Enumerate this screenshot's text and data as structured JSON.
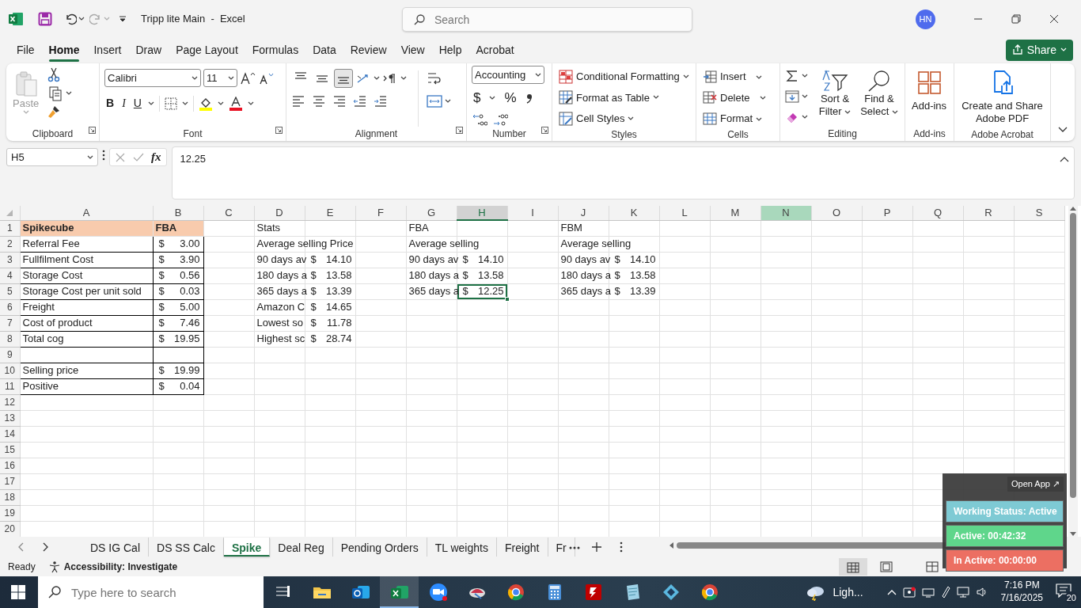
{
  "title_bar": {
    "title": "Tripp lite Main  -  Excel",
    "search_placeholder": "Search",
    "avatar": "HN"
  },
  "menu_tabs": [
    {
      "label": "File",
      "selected": false
    },
    {
      "label": "Home",
      "selected": true
    },
    {
      "label": "Insert",
      "selected": false
    },
    {
      "label": "Draw",
      "selected": false
    },
    {
      "label": "Page Layout",
      "selected": false
    },
    {
      "label": "Formulas",
      "selected": false
    },
    {
      "label": "Data",
      "selected": false
    },
    {
      "label": "Review",
      "selected": false
    },
    {
      "label": "View",
      "selected": false
    },
    {
      "label": "Help",
      "selected": false
    },
    {
      "label": "Acrobat",
      "selected": false
    }
  ],
  "share_button": {
    "label": "Share"
  },
  "ribbon": [
    {
      "kind": "clipboard",
      "label": "Clipboard",
      "paste": "Paste"
    },
    {
      "kind": "font",
      "label": "Font",
      "font_name": "Calibri",
      "font_size": "11",
      "bold": "B",
      "italic": "I",
      "underline": "U"
    },
    {
      "kind": "alignment",
      "label": "Alignment",
      "vertical_align": [
        {
          "selected": false
        },
        {
          "selected": false
        },
        {
          "selected": true
        }
      ]
    },
    {
      "kind": "number",
      "label": "Number",
      "format": "Accounting",
      "currency": "$",
      "percent": "%"
    },
    {
      "kind": "styles",
      "label": "Styles",
      "items": [
        "Conditional Formatting",
        "Format as Table",
        "Cell Styles"
      ]
    },
    {
      "kind": "cells",
      "label": "Cells",
      "items": [
        "Insert",
        "Delete",
        "Format"
      ]
    },
    {
      "kind": "editing",
      "label": "Editing",
      "items": [
        "Sort & Filter",
        "Find & Select"
      ]
    },
    {
      "kind": "addins",
      "label": "Add-ins",
      "items": [
        "Add-ins"
      ]
    },
    {
      "kind": "acrobat",
      "label": "Adobe Acrobat",
      "items": [
        "Create and Share Adobe PDF"
      ]
    }
  ],
  "formula_bar": {
    "name_box": "H5",
    "fx": "fx",
    "formula": "12.25"
  },
  "sheet": {
    "columns": [
      {
        "label": "A",
        "selected": false,
        "highlighted": false
      },
      {
        "label": "B",
        "selected": false,
        "highlighted": false
      },
      {
        "label": "C",
        "selected": false,
        "highlighted": false
      },
      {
        "label": "D",
        "selected": false,
        "highlighted": false
      },
      {
        "label": "E",
        "selected": false,
        "highlighted": false
      },
      {
        "label": "F",
        "selected": false,
        "highlighted": false
      },
      {
        "label": "G",
        "selected": false,
        "highlighted": false
      },
      {
        "label": "H",
        "selected": true,
        "highlighted": false
      },
      {
        "label": "I",
        "selected": false,
        "highlighted": false
      },
      {
        "label": "J",
        "selected": false,
        "highlighted": false
      },
      {
        "label": "K",
        "selected": false,
        "highlighted": false
      },
      {
        "label": "L",
        "selected": false,
        "highlighted": false
      },
      {
        "label": "M",
        "selected": false,
        "highlighted": false
      },
      {
        "label": "N",
        "selected": false,
        "highlighted": true
      },
      {
        "label": "O",
        "selected": false,
        "highlighted": false
      },
      {
        "label": "P",
        "selected": false,
        "highlighted": false
      },
      {
        "label": "Q",
        "selected": false,
        "highlighted": false
      },
      {
        "label": "R",
        "selected": false,
        "highlighted": false
      },
      {
        "label": "S",
        "selected": false,
        "highlighted": false
      }
    ],
    "rows": [
      {
        "label": "1",
        "cells": [
          {
            "kind": "header",
            "text": "Spikecube"
          },
          {
            "kind": "header",
            "text": "FBA"
          },
          null,
          {
            "kind": "plain",
            "text": "Stats"
          },
          null,
          null,
          {
            "kind": "plain",
            "text": "FBA"
          },
          null,
          null,
          {
            "kind": "plain",
            "text": "FBM"
          }
        ]
      },
      {
        "label": "2",
        "cells": [
          {
            "kind": "table",
            "text": "Referral Fee"
          },
          {
            "kind": "table",
            "symbol": "$",
            "amount": "3.00"
          },
          null,
          {
            "kind": "plain",
            "text": "Average selling Price"
          },
          null,
          null,
          {
            "kind": "plain",
            "text": "Average selling"
          },
          null,
          null,
          {
            "kind": "plain",
            "text": "Average selling"
          }
        ]
      },
      {
        "label": "3",
        "cells": [
          {
            "kind": "table",
            "text": "Fullfilment Cost"
          },
          {
            "kind": "table",
            "symbol": "$",
            "amount": "3.90"
          },
          null,
          {
            "kind": "plain",
            "text": "90 days av"
          },
          {
            "kind": "plain",
            "symbol": "$",
            "amount": "14.10"
          },
          null,
          {
            "kind": "plain",
            "text": "90 days av"
          },
          {
            "kind": "plain",
            "symbol": "$",
            "amount": "14.10"
          },
          null,
          {
            "kind": "plain",
            "text": "90 days av"
          },
          {
            "kind": "plain",
            "symbol": "$",
            "amount": "14.10"
          }
        ]
      },
      {
        "label": "4",
        "cells": [
          {
            "kind": "table",
            "text": "Storage Cost"
          },
          {
            "kind": "table",
            "symbol": "$",
            "amount": "0.56"
          },
          null,
          {
            "kind": "plain",
            "text": "180 days a"
          },
          {
            "kind": "plain",
            "symbol": "$",
            "amount": "13.58"
          },
          null,
          {
            "kind": "plain",
            "text": "180 days a"
          },
          {
            "kind": "plain",
            "symbol": "$",
            "amount": "13.58"
          },
          null,
          {
            "kind": "plain",
            "text": "180 days a"
          },
          {
            "kind": "plain",
            "symbol": "$",
            "amount": "13.58"
          }
        ]
      },
      {
        "label": "5",
        "cells": [
          {
            "kind": "table",
            "text": "Storage Cost per unit sold"
          },
          {
            "kind": "table",
            "symbol": "$",
            "amount": "0.03"
          },
          null,
          {
            "kind": "plain",
            "text": "365 days a"
          },
          {
            "kind": "plain",
            "symbol": "$",
            "amount": "13.39"
          },
          null,
          {
            "kind": "plain",
            "text": "365 days a"
          },
          {
            "kind": "plain",
            "symbol": "$",
            "amount": "12.25",
            "selected": true
          },
          null,
          {
            "kind": "plain",
            "text": "365 days a"
          },
          {
            "kind": "plain",
            "symbol": "$",
            "amount": "13.39"
          }
        ]
      },
      {
        "label": "6",
        "cells": [
          {
            "kind": "table",
            "text": "Freight"
          },
          {
            "kind": "table",
            "symbol": "$",
            "amount": "5.00"
          },
          null,
          {
            "kind": "plain",
            "text": "Amazon C"
          },
          {
            "kind": "plain",
            "symbol": "$",
            "amount": "14.65"
          }
        ]
      },
      {
        "label": "7",
        "cells": [
          {
            "kind": "table",
            "text": "Cost of product"
          },
          {
            "kind": "table",
            "symbol": "$",
            "amount": "7.46"
          },
          null,
          {
            "kind": "plain",
            "text": "Lowest so"
          },
          {
            "kind": "plain",
            "symbol": "$",
            "amount": "11.78"
          }
        ]
      },
      {
        "label": "8",
        "cells": [
          {
            "kind": "table",
            "text": "Total cog"
          },
          {
            "kind": "table",
            "symbol": "$",
            "amount": "19.95"
          },
          null,
          {
            "kind": "plain",
            "text": "Highest sc"
          },
          {
            "kind": "plain",
            "symbol": "$",
            "amount": "28.74"
          }
        ]
      },
      {
        "label": "9",
        "cells": [
          {
            "kind": "table"
          },
          {
            "kind": "table"
          }
        ]
      },
      {
        "label": "10",
        "cells": [
          {
            "kind": "table",
            "text": "Selling price"
          },
          {
            "kind": "table",
            "symbol": "$",
            "amount": "19.99"
          }
        ]
      },
      {
        "label": "11",
        "cells": [
          {
            "kind": "table",
            "text": "Positive"
          },
          {
            "kind": "table",
            "symbol": "$",
            "amount": "0.04"
          }
        ]
      },
      {
        "label": "12"
      },
      {
        "label": "13"
      },
      {
        "label": "14"
      },
      {
        "label": "15"
      },
      {
        "label": "16"
      },
      {
        "label": "17"
      },
      {
        "label": "18"
      },
      {
        "label": "19"
      },
      {
        "label": "20"
      }
    ]
  },
  "sheet_tabs": [
    {
      "label": "DS IG Cal",
      "selected": false
    },
    {
      "label": "DS SS Calc",
      "selected": false
    },
    {
      "label": "Spike",
      "selected": true
    },
    {
      "label": "Deal Reg",
      "selected": false
    },
    {
      "label": "Pending Orders",
      "selected": false
    },
    {
      "label": "TL weights",
      "selected": false
    },
    {
      "label": "Freight",
      "selected": false
    },
    {
      "label": "Fr",
      "selected": false
    }
  ],
  "status_bar": {
    "ready": "Ready",
    "accessibility": "Accessibility: Investigate"
  },
  "widget": {
    "open_app": "Open App ↗",
    "items": [
      {
        "text": "Working Status: Active",
        "color": "#7ecad4"
      },
      {
        "text": "Active: 00:42:32",
        "color": "#5fd68b"
      },
      {
        "text": "In Active: 00:00:00",
        "color": "#ec6f62"
      }
    ]
  },
  "taskbar": {
    "search_placeholder": "Type here to search",
    "apps": [
      {
        "kind": "taskview",
        "selected": false
      },
      {
        "kind": "folder",
        "selected": false
      },
      {
        "kind": "mail",
        "selected": false
      },
      {
        "kind": "spreadsheet",
        "selected": true
      },
      {
        "kind": "video",
        "selected": false
      },
      {
        "kind": "bird",
        "selected": false
      },
      {
        "kind": "browser",
        "selected": false
      },
      {
        "kind": "calculator",
        "selected": false
      },
      {
        "kind": "ftp",
        "selected": false
      },
      {
        "kind": "notes",
        "selected": false
      },
      {
        "kind": "diamond",
        "selected": false
      },
      {
        "kind": "browser",
        "selected": false
      }
    ],
    "weather": "Ligh...",
    "time": "7:16 PM",
    "date": "7/16/2025",
    "notifications": "20"
  }
}
